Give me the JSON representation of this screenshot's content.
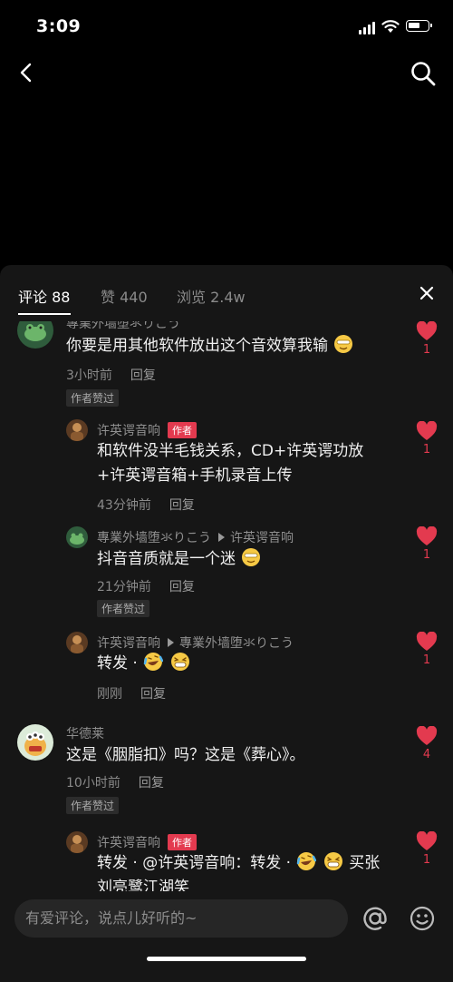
{
  "status_bar": {
    "time": "3:09"
  },
  "colors": {
    "accent": "#e33a4f",
    "sheet_bg": "#161616",
    "badge_bg": "#2c2c2c"
  },
  "header": {
    "back_icon": "chevron-left-icon",
    "search_icon": "search-icon"
  },
  "tabs": [
    {
      "label": "评论 88",
      "active": true
    },
    {
      "label": "赞 440",
      "active": false
    },
    {
      "label": "浏览 2.4w",
      "active": false
    }
  ],
  "comments": [
    {
      "user": "專業外墙堕氺りこう",
      "text": "你要是用其他软件放出这个音效算我输",
      "time": "3小时前",
      "reply": "回复",
      "badge": "作者赞过",
      "likes": "1"
    },
    {
      "user": "许英谔音响",
      "tag": "作者",
      "text_line1": "和软件没半毛钱关系，CD+许英谔功放",
      "text_line2": "+许英谔音箱+手机录音上传",
      "time": "43分钟前",
      "reply": "回复",
      "likes": "1"
    },
    {
      "user": "專業外墙堕氺りこう",
      "reply_to": "许英谔音响",
      "text": "抖音音质就是一个迷",
      "time": "21分钟前",
      "reply": "回复",
      "badge": "作者赞过",
      "likes": "1"
    },
    {
      "user": "许英谔音响",
      "reply_to": "專業外墙堕氺りこう",
      "text": "转发 · ",
      "time": "刚刚",
      "reply": "回复",
      "likes": "1"
    },
    {
      "user": "华德莱",
      "text": "这是《胭脂扣》吗？这是《葬心》。",
      "time": "10小时前",
      "reply": "回复",
      "badge": "作者赞过",
      "likes": "4"
    },
    {
      "user": "许英谔音响",
      "tag": "作者",
      "text_line1_a": "转发 · @许英谔音响：转发 · ",
      "text_line1_b": "买张",
      "text_line2": "刘亮鹭江湖笑",
      "likes": "1"
    }
  ],
  "input": {
    "placeholder": "有爱评论，说点儿好听的~"
  }
}
